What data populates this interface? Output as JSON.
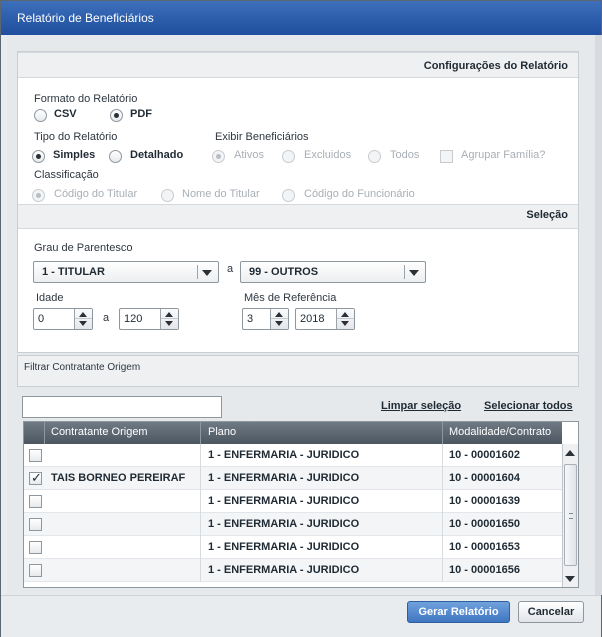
{
  "window": {
    "title": "Relatório de Beneficiários"
  },
  "config": {
    "section_title": "Configurações do Relatório",
    "formato_label": "Formato do Relatório",
    "formato_options": [
      "CSV",
      "PDF"
    ],
    "formato_selected": "PDF",
    "tipo_label": "Tipo do Relatório",
    "tipo_options": [
      "Simples",
      "Detalhado"
    ],
    "tipo_selected": "Simples",
    "exibir_label": "Exibir Beneficiários",
    "exibir_options": [
      "Ativos",
      "Excluidos",
      "Todos"
    ],
    "exibir_selected": "Ativos",
    "agrupar_label": "Agrupar Família?",
    "classificacao_label": "Classificação",
    "classificacao_options": [
      "Código do Titular",
      "Nome do Titular",
      "Código do Funcionário"
    ],
    "classificacao_selected": "Código do Titular"
  },
  "selecao": {
    "section_title": "Seleção",
    "grau_label": "Grau de Parentesco",
    "grau_from": "1 - TITULAR",
    "grau_to": "99 - OUTROS",
    "a_sep": "a",
    "idade_label": "Idade",
    "idade_from": "0",
    "idade_to": "120",
    "mes_label": "Mês de Referência",
    "mes_value": "3",
    "ano_value": "2018"
  },
  "filtro": {
    "section_title": "Filtrar Contratante Origem",
    "search_value": "",
    "limpar_label": "Limpar seleção",
    "selecionar_label": "Selecionar todos"
  },
  "grid": {
    "columns": [
      "Contratante Origem",
      "Plano",
      "Modalidade/Contrato"
    ],
    "rows": [
      {
        "checked": false,
        "contratante": "",
        "plano": "1 - ENFERMARIA - JURIDICO",
        "contrato": "10 - 00001602"
      },
      {
        "checked": true,
        "contratante": "TAIS BORNEO PEREIRAF",
        "plano": "1 - ENFERMARIA - JURIDICO",
        "contrato": "10 - 00001604"
      },
      {
        "checked": false,
        "contratante": "",
        "plano": "1 - ENFERMARIA - JURIDICO",
        "contrato": "10 - 00001639"
      },
      {
        "checked": false,
        "contratante": "",
        "plano": "1 - ENFERMARIA - JURIDICO",
        "contrato": "10 - 00001650"
      },
      {
        "checked": false,
        "contratante": "",
        "plano": "1 - ENFERMARIA - JURIDICO",
        "contrato": "10 - 00001653"
      },
      {
        "checked": false,
        "contratante": "",
        "plano": "1 - ENFERMARIA - JURIDICO",
        "contrato": "10 - 00001656"
      }
    ]
  },
  "footer": {
    "gerar_label": "Gerar Relatório",
    "cancelar_label": "Cancelar"
  },
  "colors": {
    "titlebar": "#2a5aa8",
    "primary_button": "#4a7fc8",
    "grid_header": "#5b6570"
  }
}
